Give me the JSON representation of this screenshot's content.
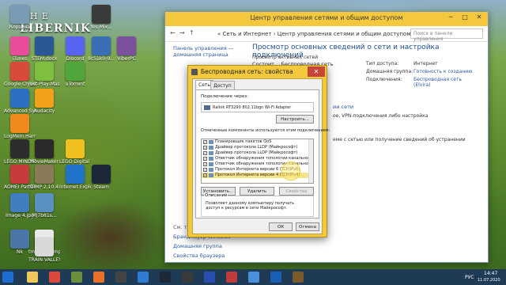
{
  "desktop": {
    "logo_line1": "T H E",
    "logo_line2": "LIBERNIK",
    "icons": [
      {
        "label": "Корзина",
        "color": "#7a9bb5"
      },
      {
        "label": "iTunes",
        "color": "#e84c9a"
      },
      {
        "label": "Google Chrome",
        "color": "#d94a3a"
      },
      {
        "label": "Advanced SystemCare",
        "color": "#2d6fc2"
      },
      {
        "label": "LogMeIn Hamachi",
        "color": "#f08a1c"
      },
      {
        "label": "LEGO MINDSTORMS",
        "color": "#2d2d2d"
      },
      {
        "label": "AOMEI Partition...",
        "color": "#c93b3b"
      },
      {
        "label": "Image 4.jpg",
        "color": "#3f7fbf"
      },
      {
        "label": "Nk",
        "color": "#4a76a8"
      },
      {
        "label": "tmpD1FA.tmp",
        "color": "#e9e9e9"
      },
      {
        "label": "STEM.docx",
        "color": "#2b5797"
      },
      {
        "label": "Just-Play-Mass...",
        "color": "#7fbf3f"
      },
      {
        "label": "Audacity",
        "color": "#f0a21a"
      },
      {
        "label": "MovieMaker",
        "color": "#2a2a2a"
      },
      {
        "label": "GIMP 2.10.4",
        "color": "#8a7a5a"
      },
      {
        "label": "MJ7b81s...",
        "color": "#5a8fc2"
      },
      {
        "label": "TRAIN VALLEY.lnk",
        "color": "#d8d8d8"
      },
      {
        "label": "Yes Mix...",
        "color": "#3a3a3a"
      },
      {
        "label": "Discord",
        "color": "#5865f2"
      },
      {
        "label": "8c51k0-9...",
        "color": "#3a6fb5"
      },
      {
        "label": "ViberPC",
        "color": "#7b519d"
      },
      {
        "label": "uTorrent",
        "color": "#4fa73b"
      },
      {
        "label": "LEGO Digital Designer",
        "color": "#f0c020"
      },
      {
        "label": "Internet Explorer",
        "color": "#1f73c9"
      },
      {
        "label": "Steam",
        "color": "#1b2838"
      }
    ]
  },
  "cp": {
    "title": "Центр управления сетями и общим доступом",
    "breadcrumb": "« Сеть и Интернет › Центр управления сетями и общим доступом",
    "search_placeholder": "Поиск в панели управления",
    "heading": "Просмотр основных сведений о сети и настройка подключений",
    "sidebar": {
      "link1": "Панель управления —",
      "link2": "домашняя страница",
      "see_also": "См. также",
      "link3": "Брандмауэр Windows",
      "link4": "Домашняя группа",
      "link5": "Свойства браузера"
    },
    "active_networks": "Просмотр активных сетей",
    "network_name": "Состоит… Беспроводная сеть",
    "access_type_label": "Тип доступа:",
    "access_type_value": "Интернет",
    "homegroup_label": "Домашняя группа:",
    "homegroup_value": "Готовность к созданию",
    "connections_label": "Подключения:",
    "connections_value": "Беспроводная сеть (Elvira)",
    "change_settings": "ии сети",
    "text1": "ое, VPN-подключения либо настройка",
    "text2": "еме с сетью или получение сведений об устранении"
  },
  "dialog": {
    "title": "Беспроводная сеть: свойства",
    "tab_network": "Сеть",
    "tab_access": "Доступ",
    "connect_via_label": "Подключение через:",
    "adapter": "Ralink RT3290 802.11bgn Wi-Fi Adapter",
    "configure_button": "Настроить...",
    "components_label": "Отмеченные компоненты используются этим подключением:",
    "components": [
      {
        "label": "Планировщик пакетов QoS",
        "checked": true,
        "selected": false
      },
      {
        "label": "Драйвер протокола LLDP (Майкрософт)",
        "checked": true,
        "selected": false
      },
      {
        "label": "Драйвер протокола LLDP (Майкрософт)",
        "checked": true,
        "selected": false
      },
      {
        "label": "Ответчик обнаружения топологии канального уровня",
        "checked": true,
        "selected": false
      },
      {
        "label": "Ответчик обнаружения топологии канального уровня",
        "checked": true,
        "selected": false
      },
      {
        "label": "Протокол Интернета версии 6 (TCP/IPv6)",
        "checked": true,
        "selected": false
      },
      {
        "label": "Протокол Интернета версии 4 (TCP/IPv4)",
        "checked": true,
        "selected": true
      }
    ],
    "install_button": "Установить...",
    "remove_button": "Удалить",
    "properties_button": "Свойства",
    "description_legend": "Описание",
    "description_text": "Позволяет данному компьютеру получать доступ к ресурсам в сети Майкрософт.",
    "ok_button": "ОК",
    "cancel_button": "Отмена"
  },
  "taskbar": {
    "language": "РУС",
    "time": "14:47",
    "date": "11.07.2020",
    "apps": [
      "file-explorer",
      "chrome",
      "minecraft",
      "firefox",
      "settings",
      "store",
      "steam",
      "calculator",
      "q-app",
      "paint",
      "photos",
      "outlook",
      "game-app"
    ]
  }
}
